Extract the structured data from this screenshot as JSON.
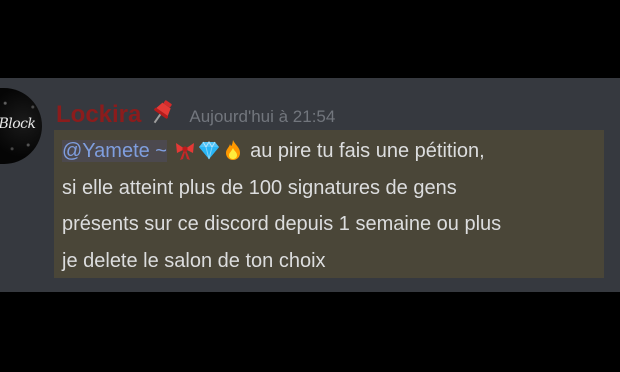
{
  "message": {
    "avatar_text": "Block",
    "username": "Lockira",
    "username_color": "#8b1c1c",
    "username_badge_icon": "pushpin-icon",
    "timestamp": "Aujourd'hui à 21:54",
    "mention": "@Yamete ~",
    "mention_emojis": [
      "ribbon-icon",
      "gem-icon",
      "fire-icon"
    ],
    "lines": [
      " au pire tu fais une pétition,",
      "si elle atteint plus de 100 signatures de gens",
      "présents sur ce discord depuis 1 semaine ou plus",
      "je delete le salon de ton choix"
    ],
    "highlighted": true
  },
  "colors": {
    "background": "#36393f",
    "highlight": "#4a4638",
    "mention": "#7f9ede",
    "text": "#dcddde",
    "timestamp": "#72767d"
  }
}
